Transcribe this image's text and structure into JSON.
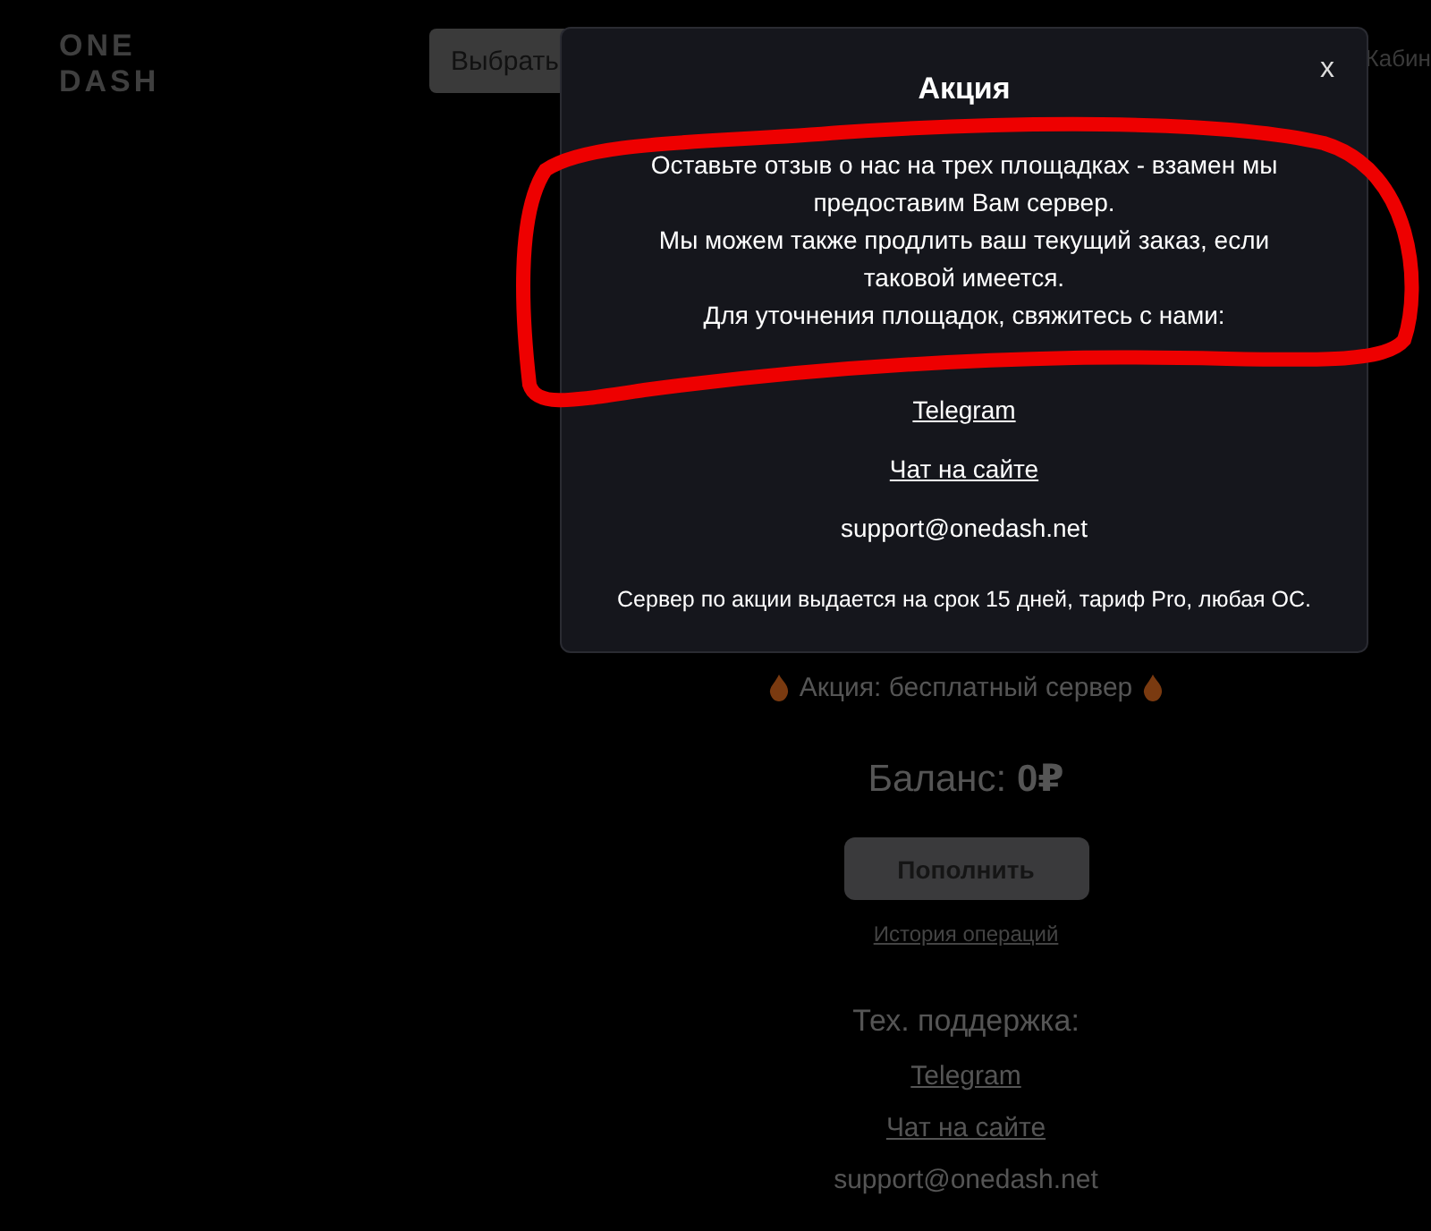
{
  "header": {
    "logo_lines": [
      "ONE",
      "DASH"
    ],
    "button": "Выбрать",
    "nav_item": "Кабин"
  },
  "promo": "Акция: бесплатный сервер",
  "balance": "Баланс: **0₽**",
  "top_up_button": "Пополнить",
  "history_link": "История операций",
  "support": {
    "heading": "Тех. поддержка:",
    "links": [
      "Telegram",
      "Чат на сайте"
    ],
    "email": "support@onedash.net"
  },
  "modal": {
    "title": "Акция",
    "close": "x",
    "paragraphs": [
      "Оставьте отзыв о нас на трех площадках - взамен мы предоставим Вам сервер.",
      "Мы можем также продлить ваш текущий заказ, если таковой имеется.",
      "Для уточнения площадок, свяжитесь с нами:"
    ],
    "links": [
      "Telegram",
      "Чат на сайте"
    ],
    "email": "support@onedash.net",
    "note": "Сервер по акции выдается на срок 15 дней, тариф Pro, любая ОС."
  }
}
